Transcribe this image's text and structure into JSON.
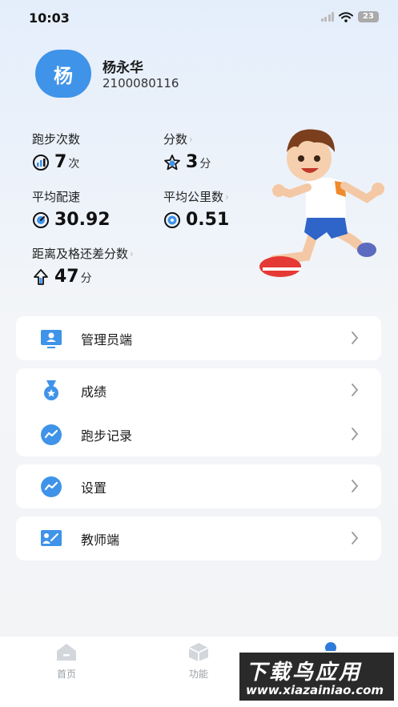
{
  "status": {
    "time": "10:03",
    "battery": "23"
  },
  "profile": {
    "avatar_char": "杨",
    "name": "杨永华",
    "id": "2100080116"
  },
  "stats": {
    "run_count": {
      "label": "跑步次数",
      "value": "7",
      "unit": "次"
    },
    "score": {
      "label": "分数",
      "value": "3",
      "unit": "分"
    },
    "avg_pace": {
      "label": "平均配速",
      "value": "30.92"
    },
    "avg_km": {
      "label": "平均公里数",
      "value": "0.51"
    },
    "gap": {
      "label": "距离及格还差分数",
      "value": "47",
      "unit": "分"
    }
  },
  "menu": {
    "admin": "管理员端",
    "grades": "成绩",
    "run_records": "跑步记录",
    "settings": "设置",
    "teacher": "教师端"
  },
  "tabs": {
    "home": "首页",
    "features": "功能"
  },
  "watermark": {
    "title": "下载鸟应用",
    "url": "www.xiazainiao.com"
  },
  "colors": {
    "accent": "#3f93e9",
    "chevron": "#bbbbbb",
    "tab_inactive": "#9aa0a6"
  }
}
